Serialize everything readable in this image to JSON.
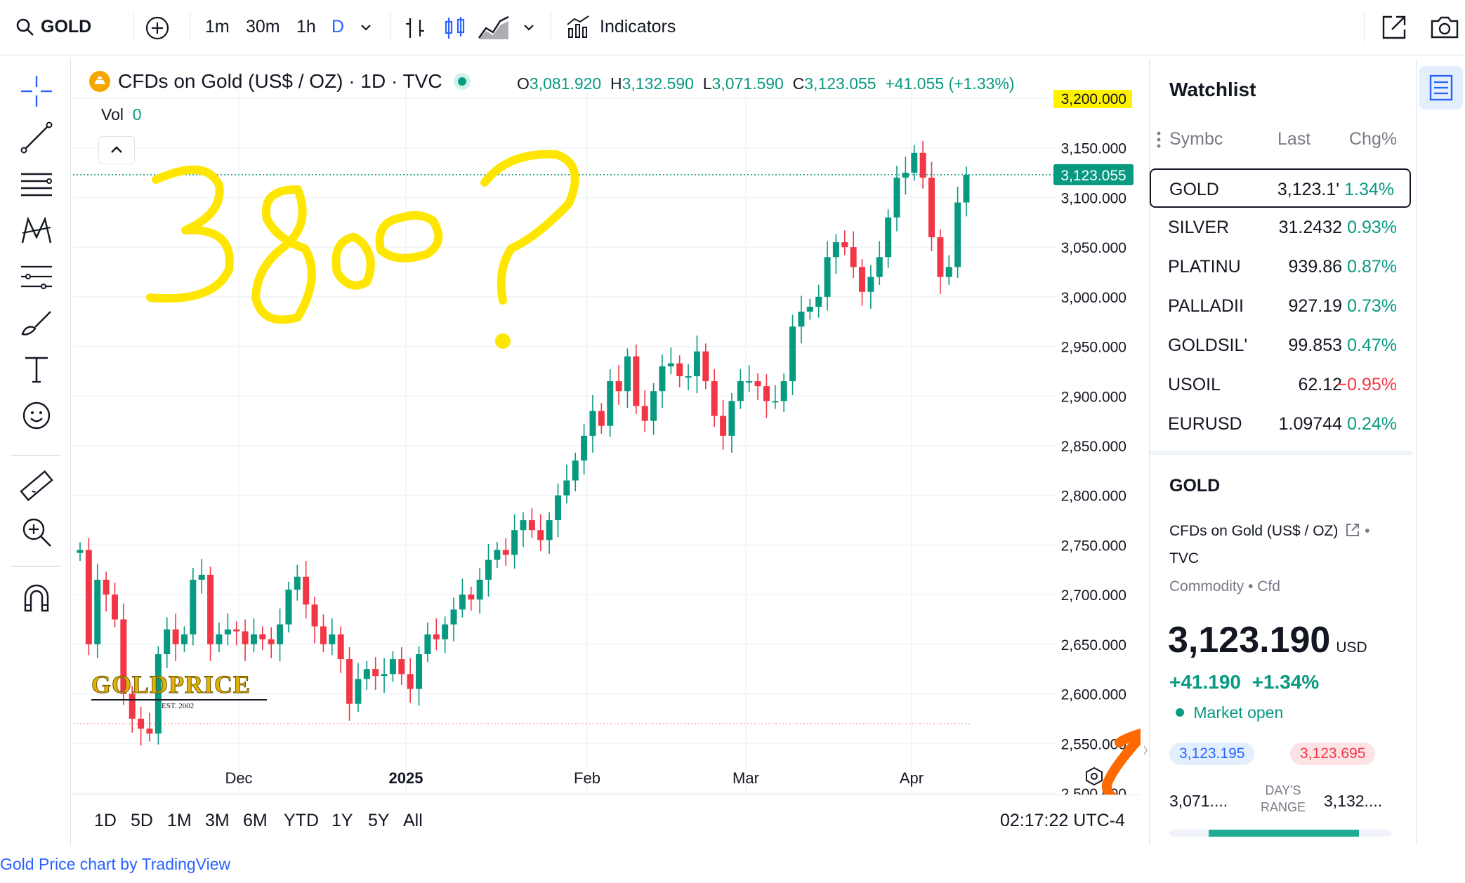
{
  "toolbar": {
    "symbol": "GOLD",
    "intervals": [
      "1m",
      "30m",
      "1h",
      "D"
    ],
    "indicators_label": "Indicators"
  },
  "legend": {
    "title": "CFDs on Gold (US$ / OZ) · 1D · TVC",
    "o_label": "O",
    "o_value": "3,081.920",
    "h_label": "H",
    "h_value": "3,132.590",
    "l_label": "L",
    "l_value": "3,071.590",
    "c_label": "C",
    "c_value": "3,123.055",
    "change": "+41.055 (+1.33%)",
    "vol_label": "Vol",
    "vol_value": "0"
  },
  "price_axis": {
    "labels": [
      "3,200.000",
      "3,150.000",
      "3,100.000",
      "3,050.000",
      "3,000.000",
      "2,950.000",
      "2,900.000",
      "2,850.000",
      "2,800.000",
      "2,750.000",
      "2,700.000",
      "2,650.000",
      "2,600.000",
      "2,550.000",
      "2,500.000"
    ],
    "last_price_tag": "3,123.055",
    "highlight_color": "#fff200"
  },
  "time_axis": {
    "labels": [
      "Dec",
      "2025",
      "Feb",
      "Mar",
      "Apr"
    ]
  },
  "annotation": {
    "handwritten_text": "3800?",
    "color": "#ffe600",
    "circle_color": "#ff6a00"
  },
  "watermark": {
    "brand": "GOLDPRICE",
    "est": "EST. 2002"
  },
  "range_bar": {
    "ranges": [
      "1D",
      "5D",
      "1M",
      "3M",
      "6M",
      "YTD",
      "1Y",
      "5Y",
      "All"
    ],
    "clock": "02:17:22 UTC-4"
  },
  "watchlist": {
    "title": "Watchlist",
    "col_symbol": "Symbc",
    "col_last": "Last",
    "col_chg": "Chg%",
    "rows": [
      {
        "symbol": "GOLD",
        "last": "3,123.1'",
        "chg": "1.34%",
        "dir": "up"
      },
      {
        "symbol": "SILVER",
        "last": "31.2432",
        "chg": "0.93%",
        "dir": "up"
      },
      {
        "symbol": "PLATINU",
        "last": "939.86",
        "chg": "0.87%",
        "dir": "up"
      },
      {
        "symbol": "PALLADII",
        "last": "927.19",
        "chg": "0.73%",
        "dir": "up"
      },
      {
        "symbol": "GOLDSIL'",
        "last": "99.853",
        "chg": "0.47%",
        "dir": "up"
      },
      {
        "symbol": "USOIL",
        "last": "62.12",
        "chg": "−0.95%",
        "dir": "down"
      },
      {
        "symbol": "EURUSD",
        "last": "1.09744",
        "chg": "0.24%",
        "dir": "up"
      }
    ]
  },
  "details": {
    "symbol": "GOLD",
    "name": "CFDs on Gold (US$ / OZ)",
    "exchange": "TVC",
    "category": "Commodity",
    "category_type": "Cfd",
    "price": "3,123.190",
    "currency": "USD",
    "change_abs": "+41.190",
    "change_pct": "+1.34%",
    "market_status": "Market open",
    "bid": "3,123.195",
    "ask": "3,123.695",
    "day_low": "3,071....",
    "day_high": "3,132....",
    "day_range_label_1": "DAY'S",
    "day_range_label_2": "RANGE"
  },
  "footer": {
    "credit": "Gold Price chart by TradingView"
  },
  "chart_data": {
    "type": "candlestick",
    "title": "CFDs on Gold (US$ / OZ) · 1D · TVC",
    "x_labels": [
      "Dec",
      "2025",
      "Feb",
      "Mar",
      "Apr"
    ],
    "ylim": [
      2470,
      3215
    ],
    "close_prices": [
      2745,
      2650,
      2715,
      2700,
      2675,
      2600,
      2575,
      2565,
      2560,
      2640,
      2665,
      2650,
      2660,
      2715,
      2720,
      2650,
      2660,
      2665,
      2663,
      2650,
      2660,
      2655,
      2650,
      2670,
      2705,
      2718,
      2690,
      2668,
      2650,
      2660,
      2635,
      2590,
      2615,
      2625,
      2618,
      2620,
      2635,
      2620,
      2605,
      2640,
      2660,
      2655,
      2670,
      2685,
      2700,
      2695,
      2715,
      2735,
      2745,
      2740,
      2765,
      2775,
      2765,
      2755,
      2775,
      2800,
      2815,
      2835,
      2860,
      2885,
      2870,
      2915,
      2905,
      2940,
      2890,
      2875,
      2905,
      2930,
      2933,
      2920,
      2920,
      2945,
      2915,
      2880,
      2860,
      2895,
      2915,
      2915,
      2910,
      2895,
      2895,
      2915,
      2970,
      2985,
      2990,
      3000,
      3040,
      3055,
      3050,
      3030,
      3005,
      3020,
      3040,
      3080,
      3120,
      3125,
      3145,
      3120,
      3060,
      3020,
      3030,
      3095,
      3123
    ]
  }
}
